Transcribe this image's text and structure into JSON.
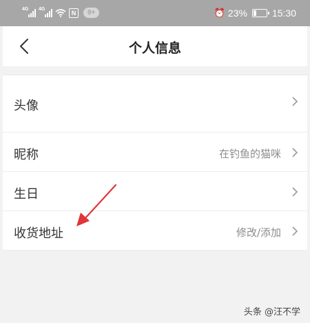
{
  "status_bar": {
    "network_1": "4G",
    "network_2": "4G",
    "nfc": "N",
    "badge": "9+",
    "battery_percent": "23%",
    "battery_level": 0.23,
    "time": "15:30"
  },
  "nav": {
    "back_icon": "chevron-left-icon",
    "title": "个人信息"
  },
  "rows": [
    {
      "label": "头像",
      "value": ""
    },
    {
      "label": "昵称",
      "value": "在钓鱼的猫咪"
    },
    {
      "label": "生日",
      "value": ""
    },
    {
      "label": "收货地址",
      "value": "修改/添加"
    }
  ],
  "annotation_color": "#e0353a",
  "watermark": "头条 @汪不学"
}
